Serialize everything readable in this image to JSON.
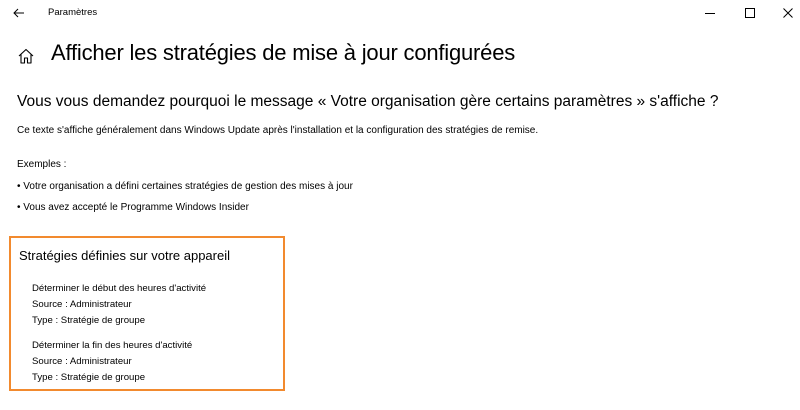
{
  "window": {
    "title": "Paramètres",
    "icons": {
      "back": "back-arrow-icon",
      "minimize": "minimize-icon",
      "maximize": "maximize-icon",
      "close": "close-icon"
    }
  },
  "page": {
    "home_icon": "home-icon",
    "title": "Afficher les stratégies de mise à jour configurées",
    "question": "Vous vous demandez pourquoi le message « Votre organisation gère certains paramètres » s'affiche ?",
    "description": "Ce texte s'affiche généralement dans Windows Update après l'installation et la configuration des stratégies de remise.",
    "examples_label": "Exemples :",
    "examples": [
      "• Votre organisation a défini certaines stratégies de gestion des mises à jour",
      "• Vous avez accepté le Programme Windows Insider"
    ]
  },
  "policies": {
    "heading": "Stratégies définies sur votre appareil",
    "highlight_color": "#f28a2e",
    "items": [
      {
        "name": "Déterminer le début des heures d'activité",
        "source": "Source : Administrateur",
        "type": "Type : Stratégie de groupe"
      },
      {
        "name": "Déterminer la fin des heures d'activité",
        "source": "Source : Administrateur",
        "type": "Type : Stratégie de groupe"
      }
    ]
  }
}
